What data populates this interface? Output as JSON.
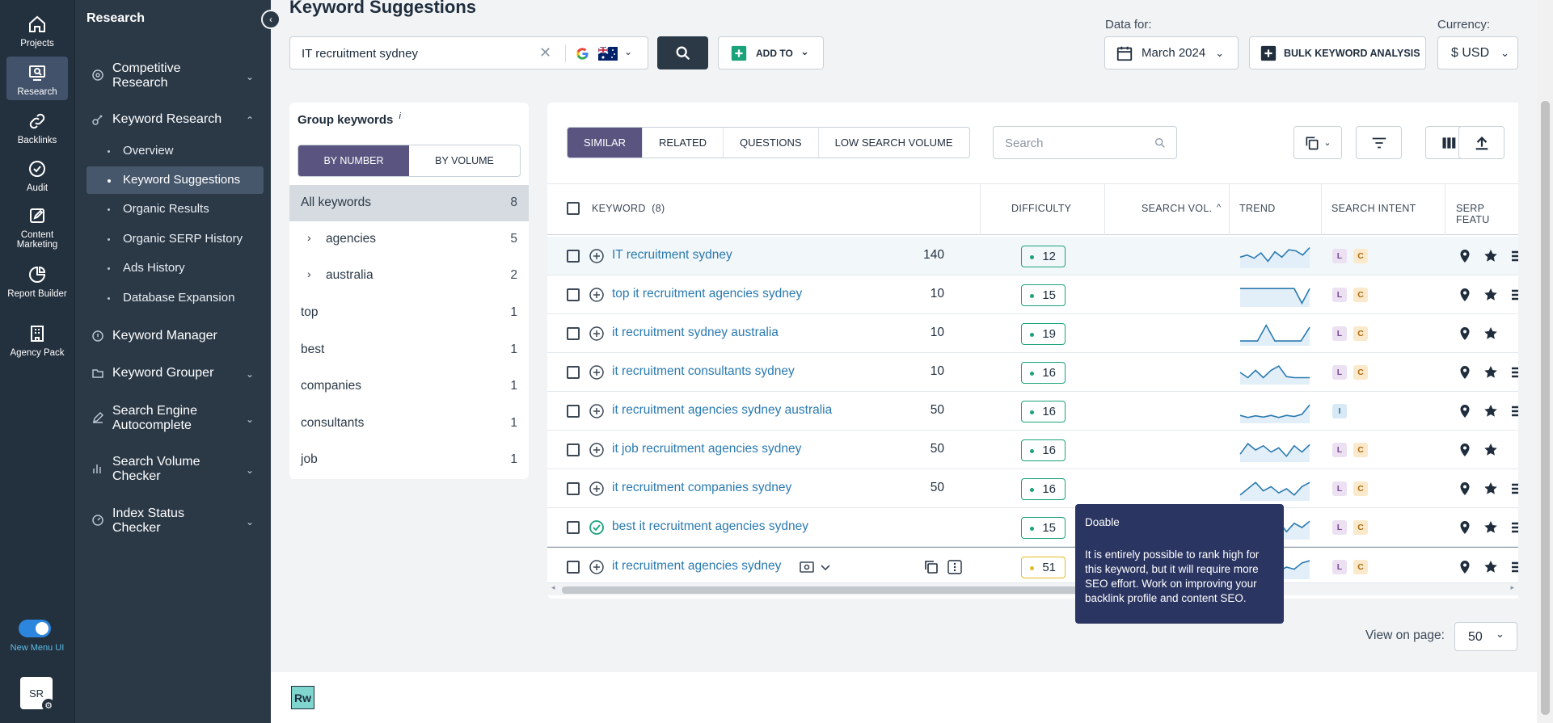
{
  "rail": {
    "items": [
      {
        "label": "Projects"
      },
      {
        "label": "Research"
      },
      {
        "label": "Backlinks"
      },
      {
        "label": "Audit"
      },
      {
        "label": "Content Marketing"
      },
      {
        "label": "Report Builder"
      },
      {
        "label": "Agency Pack"
      }
    ],
    "toggle_label": "New Menu UI",
    "avatar": "SR"
  },
  "menu": {
    "title": "Research",
    "items": [
      {
        "label": "Competitive Research"
      },
      {
        "label": "Keyword Research"
      },
      {
        "label": "Keyword Manager"
      },
      {
        "label": "Keyword Grouper"
      },
      {
        "label": "Search Engine Autocomplete"
      },
      {
        "label": "Search Volume Checker"
      },
      {
        "label": "Index Status Checker"
      }
    ],
    "subitems": [
      {
        "label": "Overview"
      },
      {
        "label": "Keyword Suggestions"
      },
      {
        "label": "Organic Results"
      },
      {
        "label": "Organic SERP History"
      },
      {
        "label": "Ads History"
      },
      {
        "label": "Database Expansion"
      }
    ]
  },
  "header": {
    "title": "Keyword Suggestions",
    "search_value": "IT recruitment sydney",
    "add_to": "ADD TO",
    "data_for_label": "Data for:",
    "date": "March 2024",
    "bulk": "BULK KEYWORD ANALYSIS",
    "currency_label": "Currency:",
    "currency": "$ USD"
  },
  "groups": {
    "title": "Group keywords",
    "info": "i",
    "by_number": "BY NUMBER",
    "by_volume": "BY VOLUME",
    "rows": [
      {
        "name": "All keywords",
        "count": "8"
      },
      {
        "name": "agencies",
        "count": "5"
      },
      {
        "name": "australia",
        "count": "2"
      },
      {
        "name": "top",
        "count": "1"
      },
      {
        "name": "best",
        "count": "1"
      },
      {
        "name": "companies",
        "count": "1"
      },
      {
        "name": "consultants",
        "count": "1"
      },
      {
        "name": "job",
        "count": "1"
      }
    ]
  },
  "table": {
    "tabs": [
      "SIMILAR",
      "RELATED",
      "QUESTIONS",
      "LOW SEARCH VOLUME"
    ],
    "search_placeholder": "Search",
    "headers": {
      "keyword": "KEYWORD",
      "keyword_count": "(8)",
      "difficulty": "DIFFICULTY",
      "volume": "SEARCH VOL.",
      "trend": "TREND",
      "intent": "SEARCH INTENT",
      "serp": "SERP FEATU"
    },
    "rows": [
      {
        "keyword": "IT recruitment sydney",
        "difficulty": "12",
        "volume": "140",
        "intent": [
          "L",
          "C"
        ],
        "trend": [
          0.55,
          0.45,
          0.6,
          0.35,
          0.75,
          0.3,
          0.55,
          0.2,
          0.25,
          0.45,
          0.1
        ]
      },
      {
        "keyword": "top it recruitment agencies sydney",
        "difficulty": "15",
        "volume": "10",
        "intent": [
          "L",
          "C"
        ],
        "trend": [
          0.2,
          0.2,
          0.2,
          0.2,
          0.2,
          0.2,
          0.2,
          0.2,
          0.9,
          0.2
        ]
      },
      {
        "keyword": "it recruitment sydney australia",
        "difficulty": "19",
        "volume": "10",
        "intent": [
          "L",
          "C"
        ],
        "trend": [
          0.85,
          0.85,
          0.85,
          0.1,
          0.85,
          0.85,
          0.85,
          0.85,
          0.2
        ]
      },
      {
        "keyword": "it recruitment consultants sydney",
        "difficulty": "16",
        "volume": "10",
        "intent": [
          "L",
          "C"
        ],
        "trend": [
          0.5,
          0.75,
          0.4,
          0.75,
          0.4,
          0.2,
          0.7,
          0.75,
          0.75,
          0.75
        ]
      },
      {
        "keyword": "it recruitment agencies sydney australia",
        "difficulty": "16",
        "volume": "50",
        "intent": [
          "I"
        ],
        "trend": [
          0.7,
          0.8,
          0.72,
          0.78,
          0.7,
          0.8,
          0.7,
          0.75,
          0.65,
          0.2
        ]
      },
      {
        "keyword": "it job recruitment agencies sydney",
        "difficulty": "16",
        "volume": "50",
        "intent": [
          "L",
          "C"
        ],
        "trend": [
          0.7,
          0.2,
          0.5,
          0.3,
          0.6,
          0.4,
          0.8,
          0.3,
          0.6,
          0.25
        ]
      },
      {
        "keyword": "it recruitment companies sydney",
        "difficulty": "16",
        "volume": "50",
        "intent": [
          "L",
          "C"
        ],
        "trend": [
          0.8,
          0.5,
          0.2,
          0.6,
          0.4,
          0.7,
          0.5,
          0.8,
          0.4,
          0.2
        ]
      },
      {
        "keyword": "best it recruitment agencies sydney",
        "difficulty": "15",
        "volume": "",
        "intent": [
          "L",
          "C"
        ],
        "trend": [
          0.6,
          0.4,
          0.5,
          0.3,
          0.6,
          0.2,
          0.7,
          0.3,
          0.5,
          0.2
        ]
      },
      {
        "keyword": "it recruitment agencies sydney",
        "difficulty": "51",
        "volume": "",
        "intent": [
          "L",
          "C"
        ],
        "trend": [
          0.7,
          0.5,
          0.8,
          0.4,
          0.6,
          0.7,
          0.5,
          0.6,
          0.3,
          0.2
        ]
      }
    ]
  },
  "tooltip": {
    "title": "Doable",
    "body": "It is entirely possible to rank high for this keyword, but it will require more SEO effort. Work on improving your backlink profile and content SEO."
  },
  "footer": {
    "view_on_page": "View on page:",
    "page_size": "50",
    "logo": "Rw"
  },
  "colors": {
    "accent": "#5a5580",
    "sidebar": "#23303d",
    "link": "#2a7ab0",
    "easy": "#1aa37b",
    "doable": "#e4bb22"
  }
}
